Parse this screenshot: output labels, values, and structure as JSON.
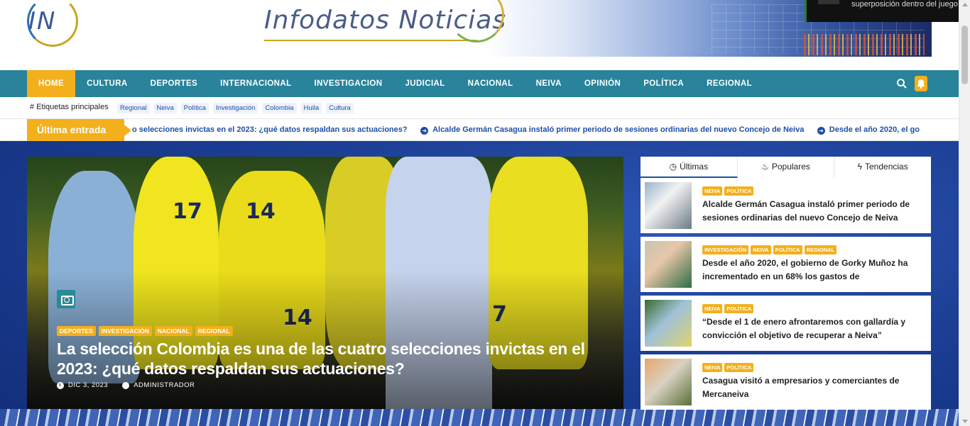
{
  "site": {
    "logo_text": "IN",
    "banner_title": "Infodatos Noticias"
  },
  "overlay": {
    "text": "superposición dentro del juego"
  },
  "nav": {
    "items": [
      {
        "label": "HOME",
        "active": true
      },
      {
        "label": "CULTURA"
      },
      {
        "label": "DEPORTES"
      },
      {
        "label": "INTERNACIONAL"
      },
      {
        "label": "INVESTIGACION"
      },
      {
        "label": "JUDICIAL"
      },
      {
        "label": "NACIONAL"
      },
      {
        "label": "NEIVA"
      },
      {
        "label": "OPINIÓN"
      },
      {
        "label": "POLÍTICA"
      },
      {
        "label": "REGIONAL"
      }
    ]
  },
  "tags": {
    "label": "Etiquetas principales",
    "items": [
      "Regional",
      "Neiva",
      "Política",
      "Investigación",
      "Colombia",
      "Huila",
      "Cultura"
    ]
  },
  "latest": {
    "label": "Última entrada",
    "items": [
      "o selecciones invictas en el 2023: ¿qué datos respaldan sus actuaciones?",
      "Alcalde Germán Casagua instaló primer periodo de sesiones ordinarias del nuevo Concejo de Neiva",
      "Desde el año 2020, el go"
    ]
  },
  "hero": {
    "categories": [
      "DEPORTES",
      "INVESTIGACIÓN",
      "NACIONAL",
      "REGIONAL"
    ],
    "title": "La selección Colombia es una de las cuatro selecciones invictas en el 2023: ¿qué datos respaldan sus actuaciones?",
    "date": "DIC 3, 2023",
    "author": "ADMINISTRADOR",
    "jersey_numbers": [
      "17",
      "14",
      "14",
      "7"
    ]
  },
  "side_tabs": [
    {
      "label": "Últimas",
      "icon": "clock-icon",
      "active": true
    },
    {
      "label": "Populares",
      "icon": "fire-icon"
    },
    {
      "label": "Tendencias",
      "icon": "bolt-icon"
    }
  ],
  "side_posts": [
    {
      "categories": [
        "NEIVA",
        "POLÍTICA"
      ],
      "title": "Alcalde Germán Casagua instaló primer periodo de sesiones ordinarias del nuevo Concejo de Neiva"
    },
    {
      "categories": [
        "INVESTIGACIÓN",
        "NEIVA",
        "POLÍTICA",
        "REGIONAL"
      ],
      "title": "Desde el año 2020, el gobierno de Gorky Muñoz ha incrementado en un 68% los gastos de"
    },
    {
      "categories": [
        "NEIVA",
        "POLÍTICA"
      ],
      "title": "“Desde el 1 de enero afrontaremos con gallardía y convicción el objetivo de recuperar a Neiva”"
    },
    {
      "categories": [
        "NEIVA",
        "POLÍTICA"
      ],
      "title": "Casagua visitó a empresarios y comerciantes de Mercaneiva"
    }
  ],
  "colors": {
    "nav_bg": "#28839b",
    "accent": "#f3b01c",
    "link": "#1e4fa6",
    "main_bg": "#1c3f95"
  }
}
